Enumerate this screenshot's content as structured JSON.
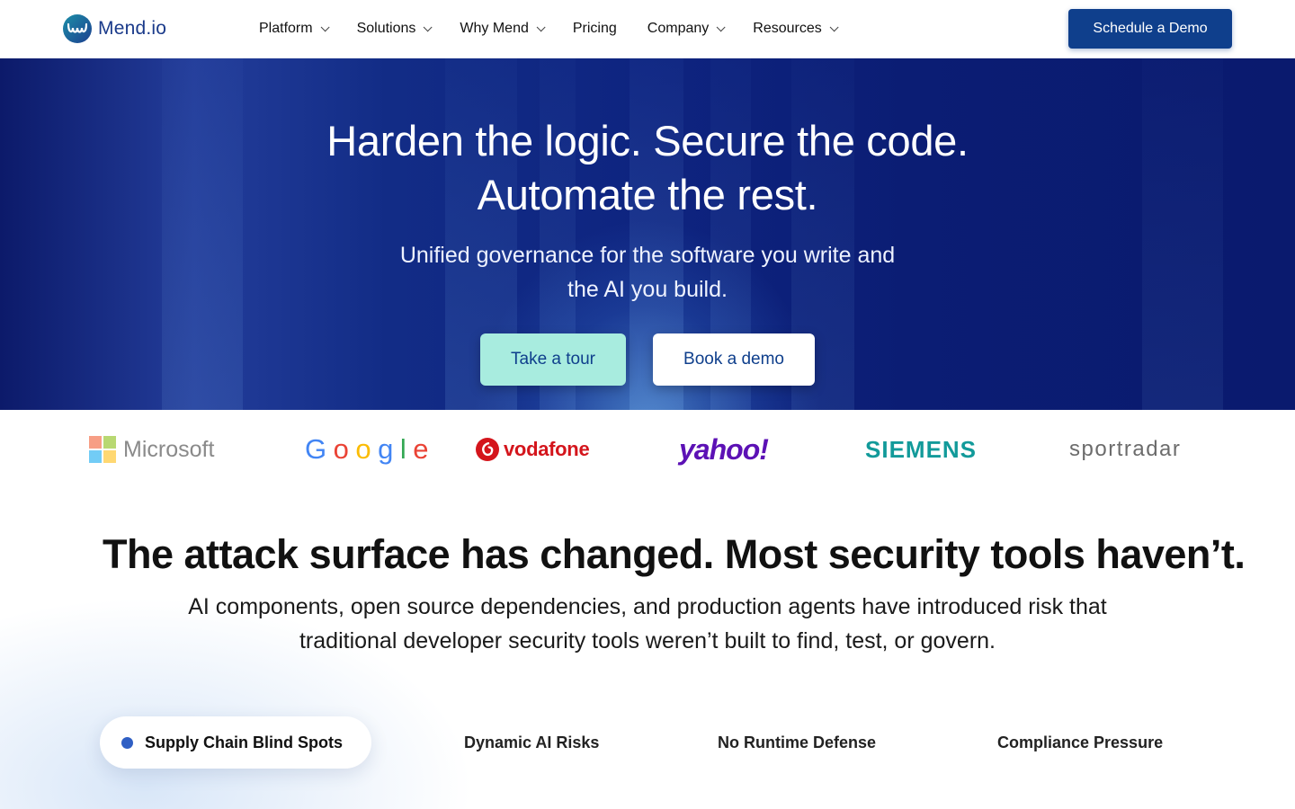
{
  "nav": {
    "logo_text": "Mend.io",
    "menu": [
      {
        "label": "Platform",
        "has_dropdown": true
      },
      {
        "label": "Solutions",
        "has_dropdown": true
      },
      {
        "label": "Why Mend",
        "has_dropdown": true
      },
      {
        "label": "Pricing",
        "has_dropdown": false
      },
      {
        "label": "Company",
        "has_dropdown": true
      },
      {
        "label": "Resources",
        "has_dropdown": true
      }
    ],
    "cta_label": "Schedule a Demo"
  },
  "hero": {
    "title_line1": "Harden the logic. Secure the code.",
    "title_line2": "Automate the rest.",
    "subtitle_line1": "Unified governance for the software you write and",
    "subtitle_line2": "the AI you build.",
    "primary_button": "Take a tour",
    "secondary_button": "Book a demo"
  },
  "logos": {
    "microsoft": "Microsoft",
    "google_letters": [
      "G",
      "o",
      "o",
      "g",
      "l",
      "e"
    ],
    "vodafone": "vodafone",
    "yahoo": "yahoo!",
    "siemens": "SIEMENS",
    "sportradar": "sportradar"
  },
  "section": {
    "title_bold": "The attack surface has changed.",
    "title_regular": " Most security tools haven’t.",
    "subtitle_line1": "AI components, open source dependencies, and production agents have introduced risk that",
    "subtitle_line2": "traditional developer security tools weren’t built to find, test, or govern.",
    "tabs": [
      {
        "label": "Supply Chain Blind Spots",
        "active": true
      },
      {
        "label": "Dynamic AI Risks",
        "active": false
      },
      {
        "label": "No Runtime Defense",
        "active": false
      },
      {
        "label": "Compliance Pressure",
        "active": false
      }
    ]
  },
  "colors": {
    "brand_blue": "#0f3f8c",
    "mint": "#a8ecdf",
    "hero_bg": "#0e2480"
  }
}
